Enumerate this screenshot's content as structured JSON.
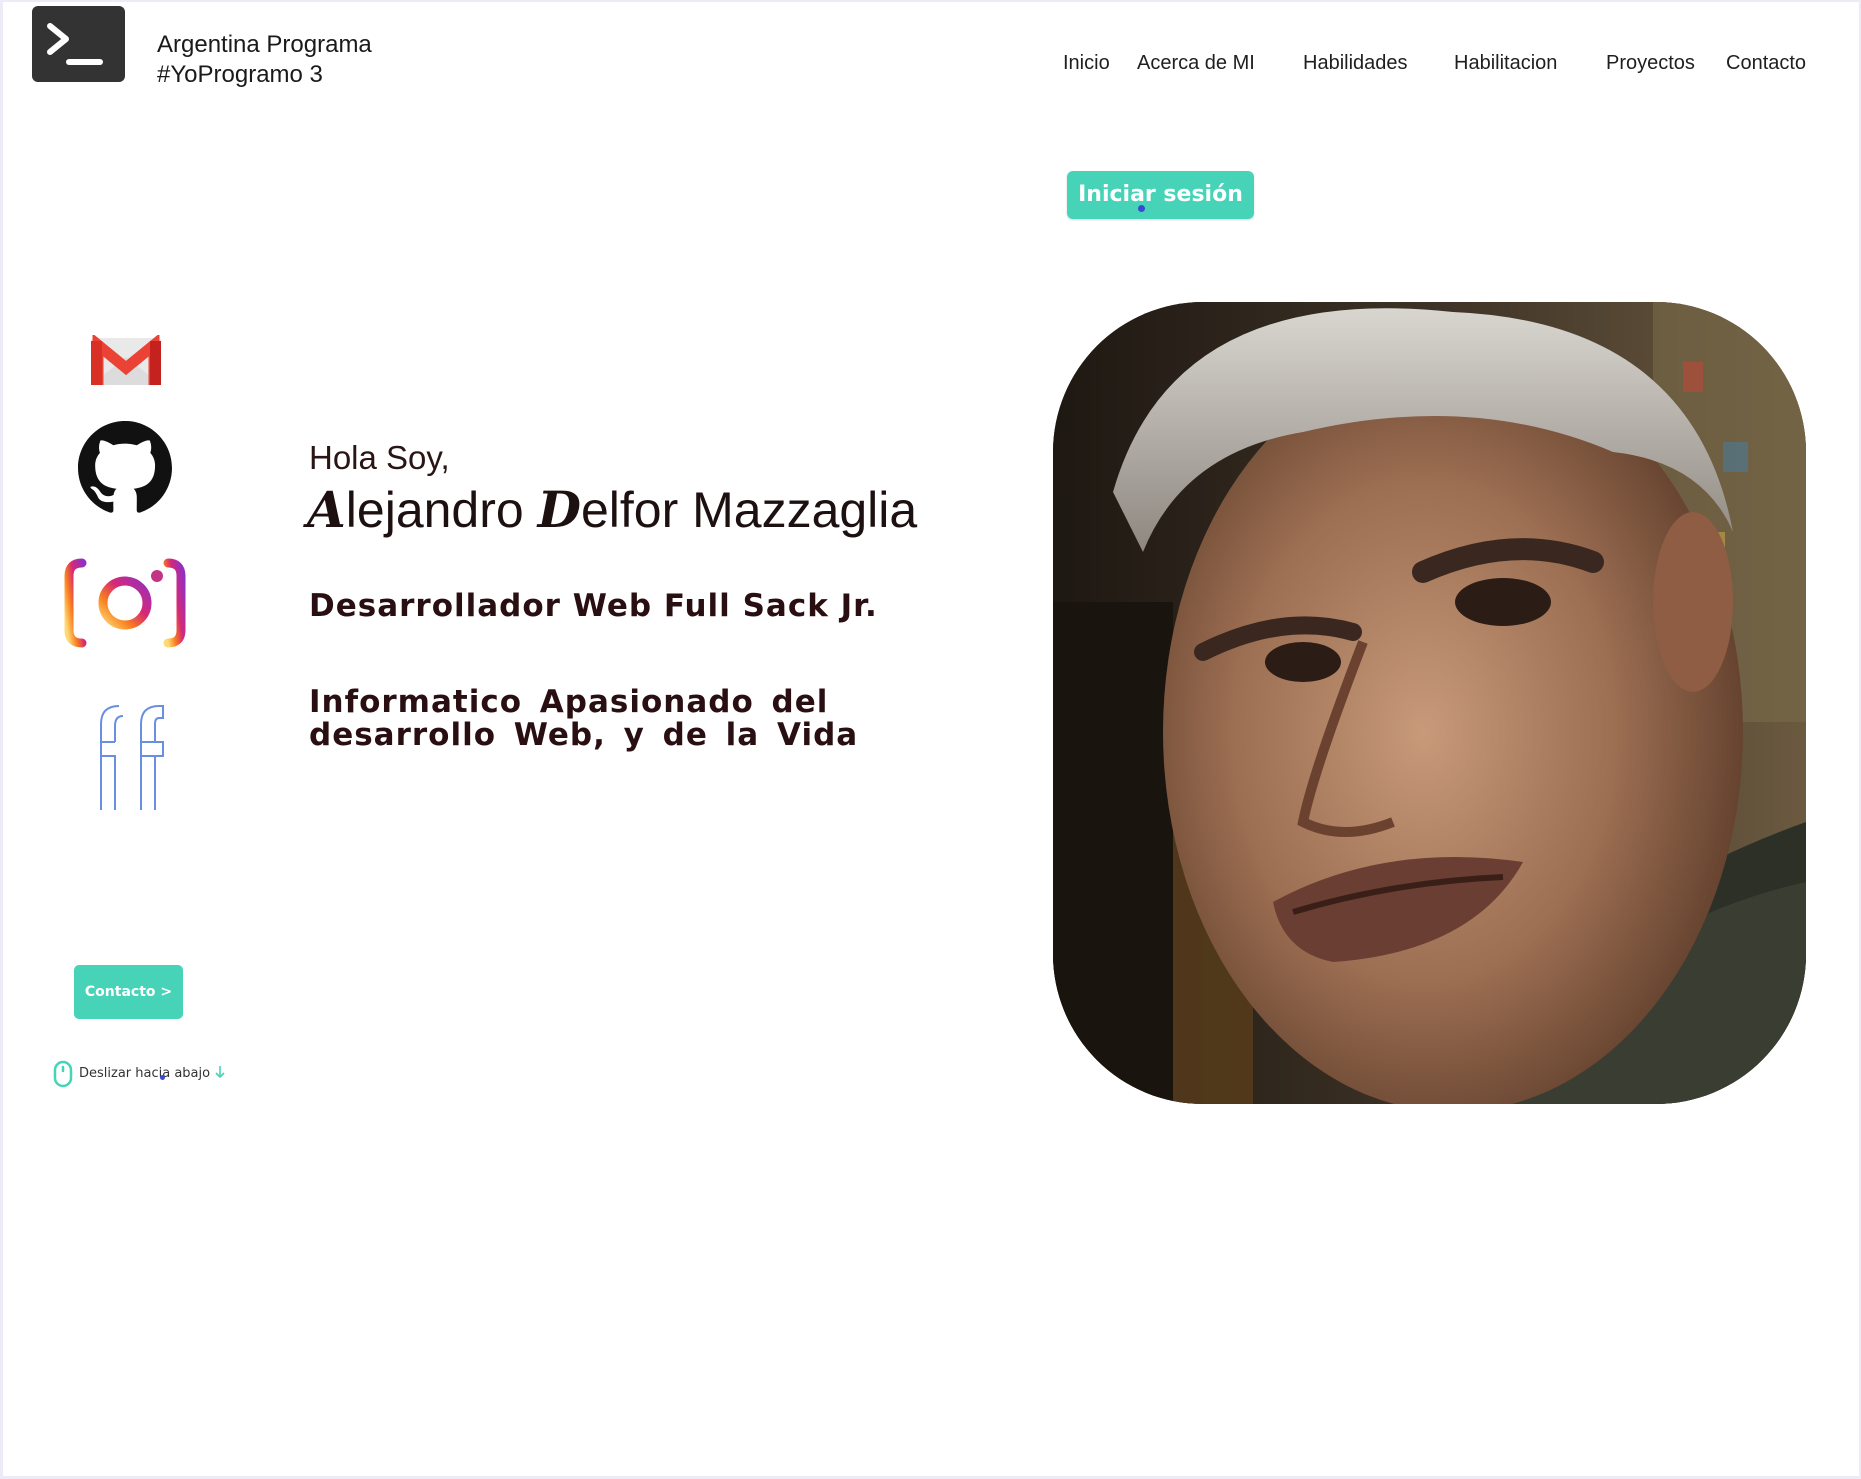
{
  "header": {
    "brand_line1": "Argentina Programa",
    "brand_line2": "#YoProgramo 3",
    "logo_icon": "terminal-icon"
  },
  "nav": {
    "items": [
      {
        "label": "Inicio"
      },
      {
        "label": "Acerca de MI"
      },
      {
        "label": "Habilidades"
      },
      {
        "label": "Habilitacion"
      },
      {
        "label": "Proyectos"
      },
      {
        "label": "Contacto"
      }
    ]
  },
  "auth": {
    "login_label": "Iniciar sesión"
  },
  "social": {
    "icons": [
      "gmail-icon",
      "github-icon",
      "instagram-icon",
      "facebook-icon"
    ]
  },
  "intro": {
    "greeting": "Hola Soy,",
    "name_first_initial": "A",
    "name_first_rest": "lejandro ",
    "name_middle_initial": "D",
    "name_rest": "elfor Mazzaglia",
    "role": "Desarrollador Web Full Sack Jr.",
    "bio": "Informatico  Apasionado  del desarrollo Web, y de la Vida"
  },
  "actions": {
    "contact_label": "Contacto >",
    "scroll_label": "Deslizar hacia abajo"
  },
  "colors": {
    "accent": "#46d3b8",
    "text_dark": "#2a0f12",
    "logo_bg": "#333333"
  }
}
